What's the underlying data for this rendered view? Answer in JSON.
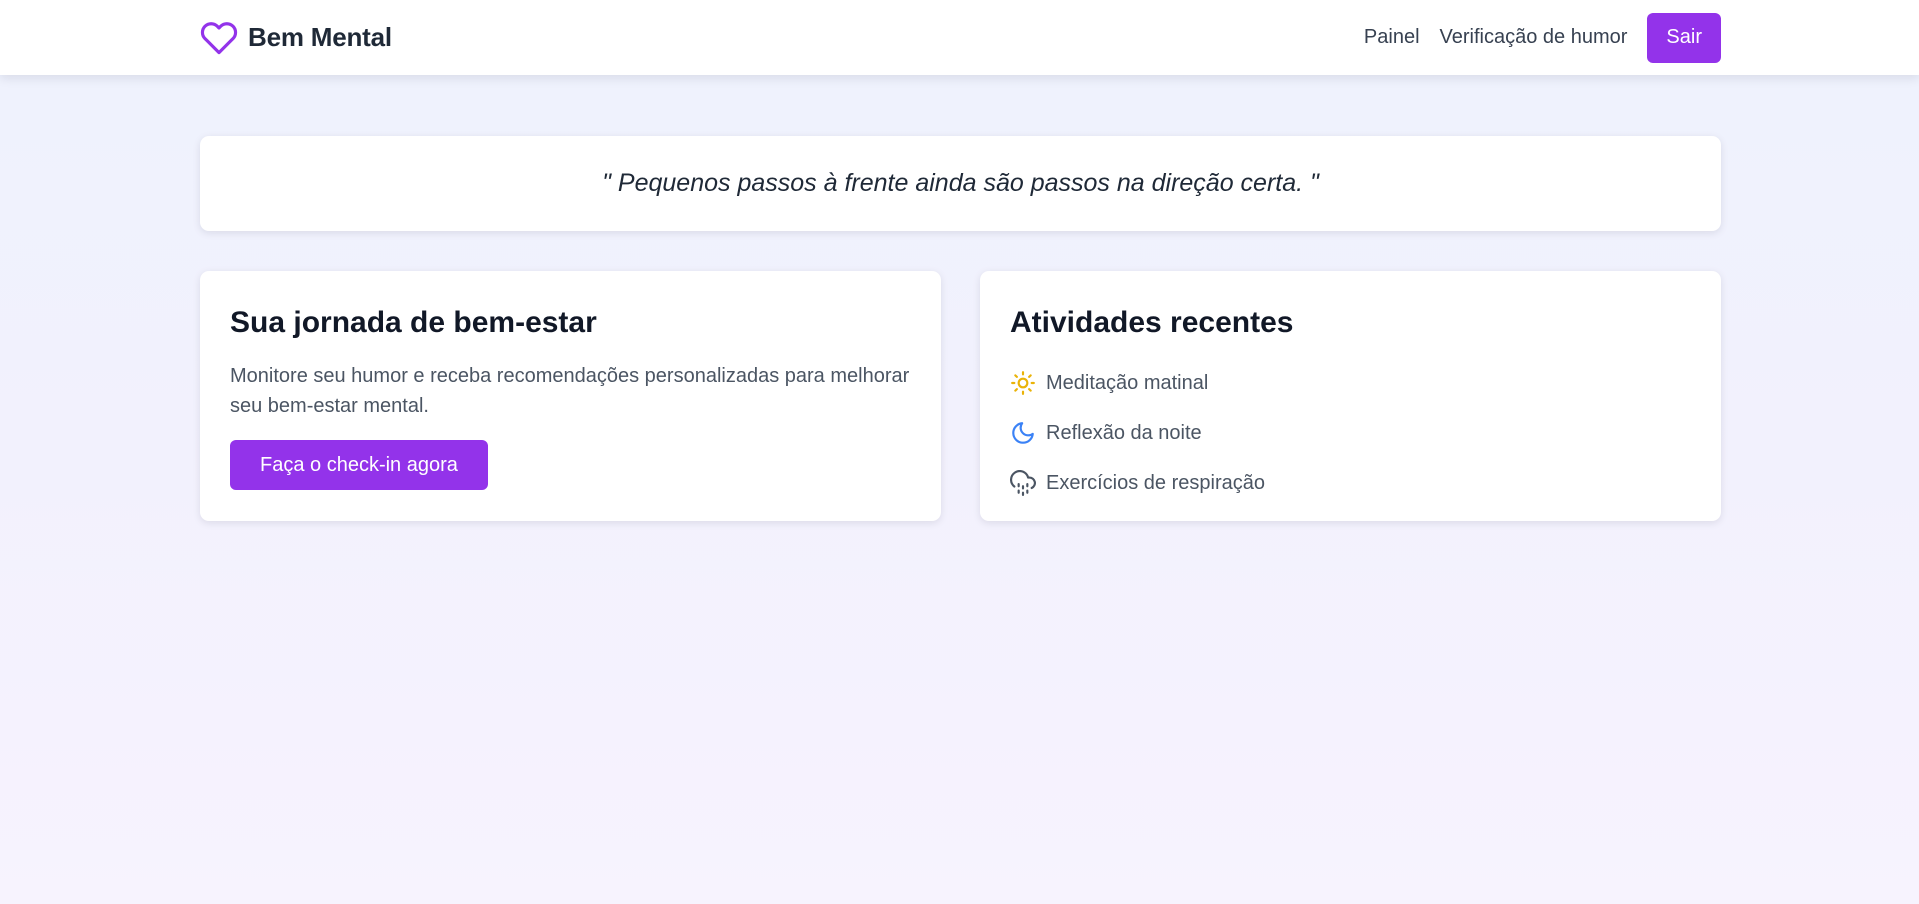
{
  "brand": {
    "name": "Bem Mental",
    "icon": "heart-icon",
    "color": "#9333ea"
  },
  "nav": {
    "links": [
      "Painel",
      "Verificação de humor"
    ],
    "logout_label": "Sair"
  },
  "quote": {
    "text": "\" Pequenos passos à frente ainda são passos na direção certa. \""
  },
  "journey": {
    "title": "Sua jornada de bem-estar",
    "description": "Monitore seu humor e receba recomendações personalizadas para melhorar seu bem-estar mental.",
    "cta_label": "Faça o check-in agora"
  },
  "activities": {
    "title": "Atividades recentes",
    "items": [
      {
        "label": "Meditação matinal",
        "icon": "sun-icon",
        "color": "#eab308"
      },
      {
        "label": "Reflexão da noite",
        "icon": "moon-icon",
        "color": "#3b82f6"
      },
      {
        "label": "Exercícios de respiração",
        "icon": "cloud-rain-icon",
        "color": "#4b5563"
      }
    ]
  },
  "colors": {
    "accent": "#9333ea",
    "text_dark": "#111827",
    "text_muted": "#4b5563"
  }
}
